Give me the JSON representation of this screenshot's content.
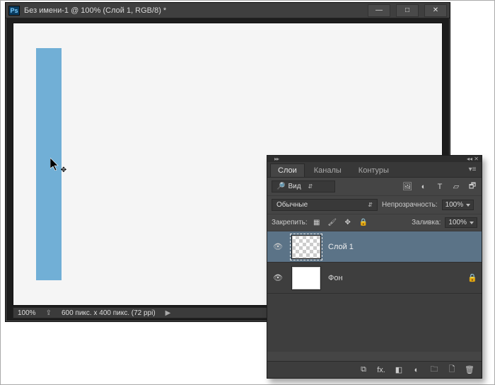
{
  "window": {
    "title": "Без имени-1 @ 100% (Слой 1, RGB/8) *",
    "logo_text": "Ps"
  },
  "status": {
    "zoom": "100%",
    "dimensions": "600 пикс. x 400 пикс. (72 ppi)"
  },
  "panel": {
    "tabs": {
      "layers": "Слои",
      "channels": "Каналы",
      "paths": "Контуры"
    },
    "filter_type": "Вид",
    "blend_mode": "Обычные",
    "opacity_label": "Непрозрачность:",
    "opacity_value": "100%",
    "lock_label": "Закрепить:",
    "fill_label": "Заливка:",
    "fill_value": "100%",
    "layers": [
      {
        "name": "Слой 1",
        "selected": true,
        "locked": false
      },
      {
        "name": "Фон",
        "selected": false,
        "locked": true
      }
    ]
  },
  "icons": {
    "minimize": "—",
    "maximize": "□",
    "close": "✕",
    "eye": "👁",
    "lock": "🔒",
    "link": "⧉",
    "fx": "fx.",
    "mask": "◧",
    "adjust": "◐",
    "folder": "🗀",
    "new": "🗋",
    "trash": "🗑",
    "image_filter": "🖼",
    "adjust_filter": "◐",
    "type_filter": "T",
    "shape_filter": "▱",
    "smart_filter": "🗗"
  }
}
